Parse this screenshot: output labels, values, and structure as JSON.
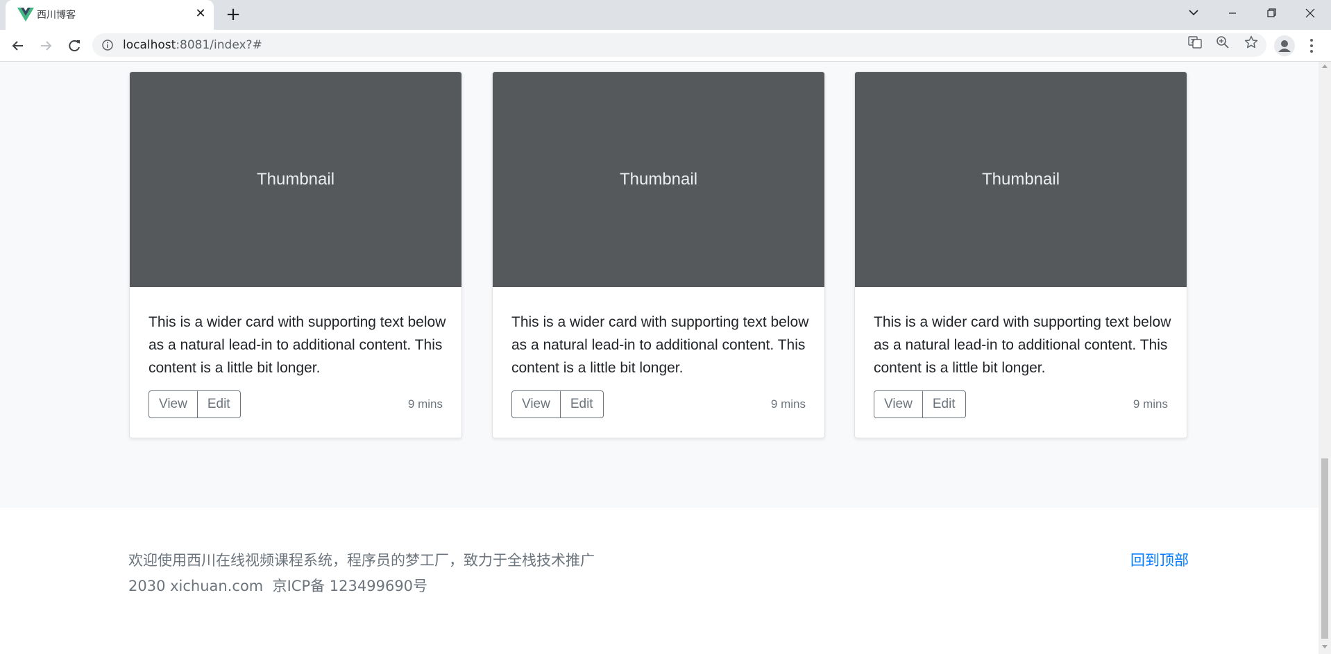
{
  "browser": {
    "tab_title": "西川博客",
    "tab_close": "✕",
    "new_tab": "+",
    "url_host": "localhost",
    "url_path": ":8081/index?#"
  },
  "cards": [
    {
      "thumbnail": "Thumbnail",
      "text": "This is a wider card with supporting text below as a natural lead-in to additional content. This content is a little bit longer.",
      "view_label": "View",
      "edit_label": "Edit",
      "time": "9 mins"
    },
    {
      "thumbnail": "Thumbnail",
      "text": "This is a wider card with supporting text below as a natural lead-in to additional content. This content is a little bit longer.",
      "view_label": "View",
      "edit_label": "Edit",
      "time": "9 mins"
    },
    {
      "thumbnail": "Thumbnail",
      "text": "This is a wider card with supporting text below as a natural lead-in to additional content. This content is a little bit longer.",
      "view_label": "View",
      "edit_label": "Edit",
      "time": "9 mins"
    }
  ],
  "footer": {
    "line1": "欢迎使用西川在线视频课程系统，程序员的梦工厂，致力于全栈技术推广",
    "line2": "2030 xichuan.com  京ICP备 123499690号",
    "back_to_top": "回到顶部"
  },
  "colors": {
    "thumbnail_bg": "#55595c",
    "link": "#007bff",
    "muted": "#6c757d",
    "page_bg": "#f8f9fa"
  }
}
